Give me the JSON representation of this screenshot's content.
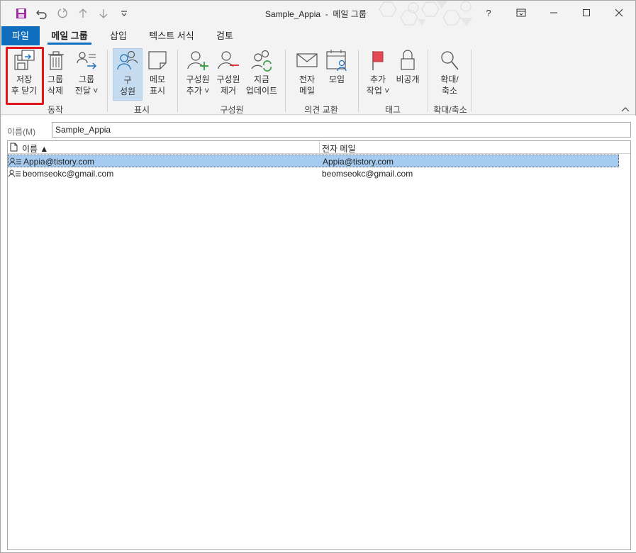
{
  "window": {
    "title": "Sample_Appia  -  메일 그룹"
  },
  "qat": {
    "icons": [
      "save-icon",
      "undo-icon",
      "redo-icon",
      "up-arrow-icon",
      "down-arrow-icon",
      "customize-icon"
    ]
  },
  "window_controls": {
    "help": "?",
    "icons": [
      "ribbon-display-icon",
      "minimize-icon",
      "maximize-icon",
      "close-icon"
    ]
  },
  "tabs": [
    {
      "label": "파일"
    },
    {
      "label": "메일 그룹"
    },
    {
      "label": "삽입"
    },
    {
      "label": "텍스트 서식"
    },
    {
      "label": "검토"
    }
  ],
  "ribbon": {
    "groups": {
      "actions": "동작",
      "show": "표시",
      "members": "구성원",
      "communicate": "의견 교환",
      "tags": "태그",
      "zoom": "확대/축소"
    },
    "buttons": {
      "save_close": [
        "저장",
        "후 닫기"
      ],
      "delete_group": [
        "그룹",
        "삭제"
      ],
      "forward_group": [
        "그룹",
        "전달 ˅"
      ],
      "members": [
        "구",
        "성원"
      ],
      "notes": [
        "메모",
        "표시"
      ],
      "add_members": [
        "구성원",
        "추가 ˅"
      ],
      "remove_member": [
        "구성원",
        "제거"
      ],
      "update_now": [
        "지금",
        "업데이트"
      ],
      "email": [
        "전자",
        "메일"
      ],
      "meeting": [
        "모임"
      ],
      "follow_up": [
        "추가",
        "작업 ˅"
      ],
      "private": [
        "비공개"
      ],
      "zoom": [
        "확대/",
        "축소"
      ]
    }
  },
  "form": {
    "name_label": "이름(M)",
    "name_value": "Sample_Appia"
  },
  "grid": {
    "columns": [
      "이름 ▲",
      "전자 메일"
    ],
    "rows": [
      {
        "name": "Appia@tistory.com",
        "email": "Appia@tistory.com",
        "selected": true
      },
      {
        "name": "beomseokc@gmail.com",
        "email": "beomseokc@gmail.com",
        "selected": false
      }
    ]
  },
  "colors": {
    "accent": "#106ebe",
    "selection": "#a6cbf0",
    "highlight_box": "#e0161b",
    "save_icon": "#9b2fa0"
  }
}
